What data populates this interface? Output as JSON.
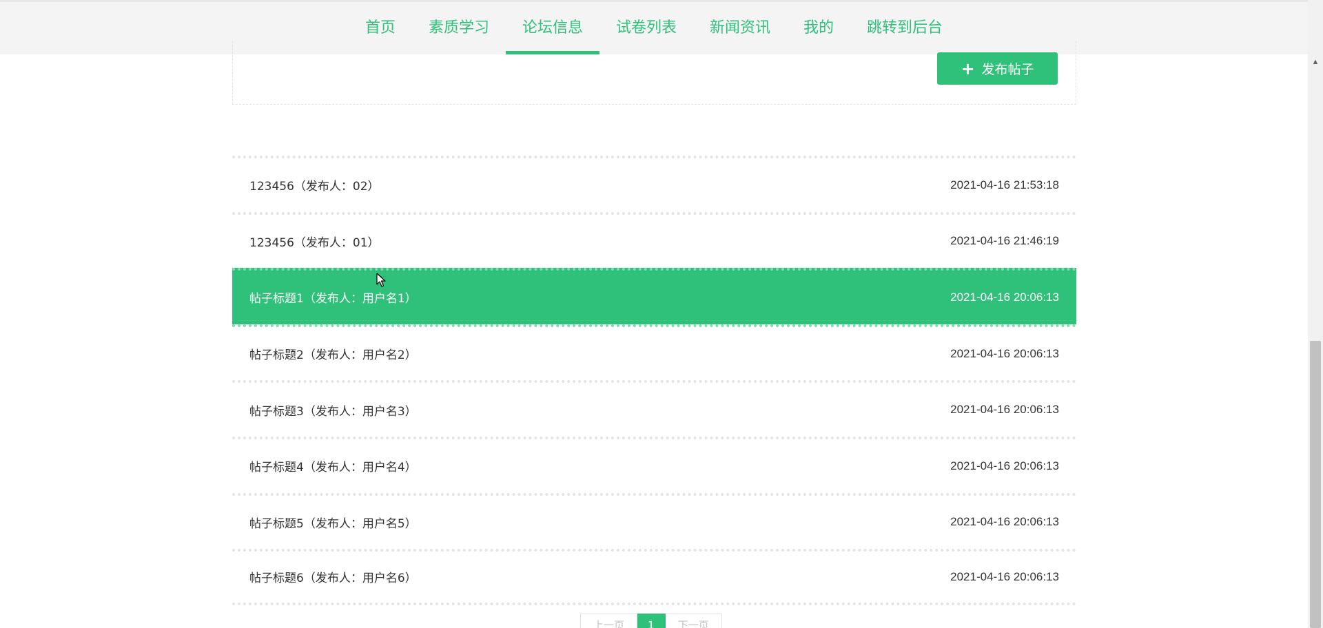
{
  "nav": {
    "items": [
      {
        "label": "首页"
      },
      {
        "label": "素质学习"
      },
      {
        "label": "论坛信息"
      },
      {
        "label": "试卷列表"
      },
      {
        "label": "新闻资讯"
      },
      {
        "label": "我的"
      },
      {
        "label": "跳转到后台"
      }
    ],
    "active_index": 2
  },
  "toolbar": {
    "publish_label": "发布帖子",
    "publish_icon": "plus-icon"
  },
  "posts": [
    {
      "title": "123456（发布人：02）",
      "time": "2021-04-16 21:53:18"
    },
    {
      "title": "123456（发布人：01）",
      "time": "2021-04-16 21:46:19"
    },
    {
      "title": "帖子标题1（发布人：用户名1）",
      "time": "2021-04-16 20:06:13"
    },
    {
      "title": "帖子标题2（发布人：用户名2）",
      "time": "2021-04-16 20:06:13"
    },
    {
      "title": "帖子标题3（发布人：用户名3）",
      "time": "2021-04-16 20:06:13"
    },
    {
      "title": "帖子标题4（发布人：用户名4）",
      "time": "2021-04-16 20:06:13"
    },
    {
      "title": "帖子标题5（发布人：用户名5）",
      "time": "2021-04-16 20:06:13"
    },
    {
      "title": "帖子标题6（发布人：用户名6）",
      "time": "2021-04-16 20:06:13"
    }
  ],
  "highlighted_post_index": 2,
  "pagination": {
    "prev_label": "上一页",
    "current_page": "1",
    "next_label": "下一页"
  },
  "colors": {
    "accent": "#2fc17a",
    "nav_bg": "#f4f4f4",
    "text": "#333333"
  }
}
